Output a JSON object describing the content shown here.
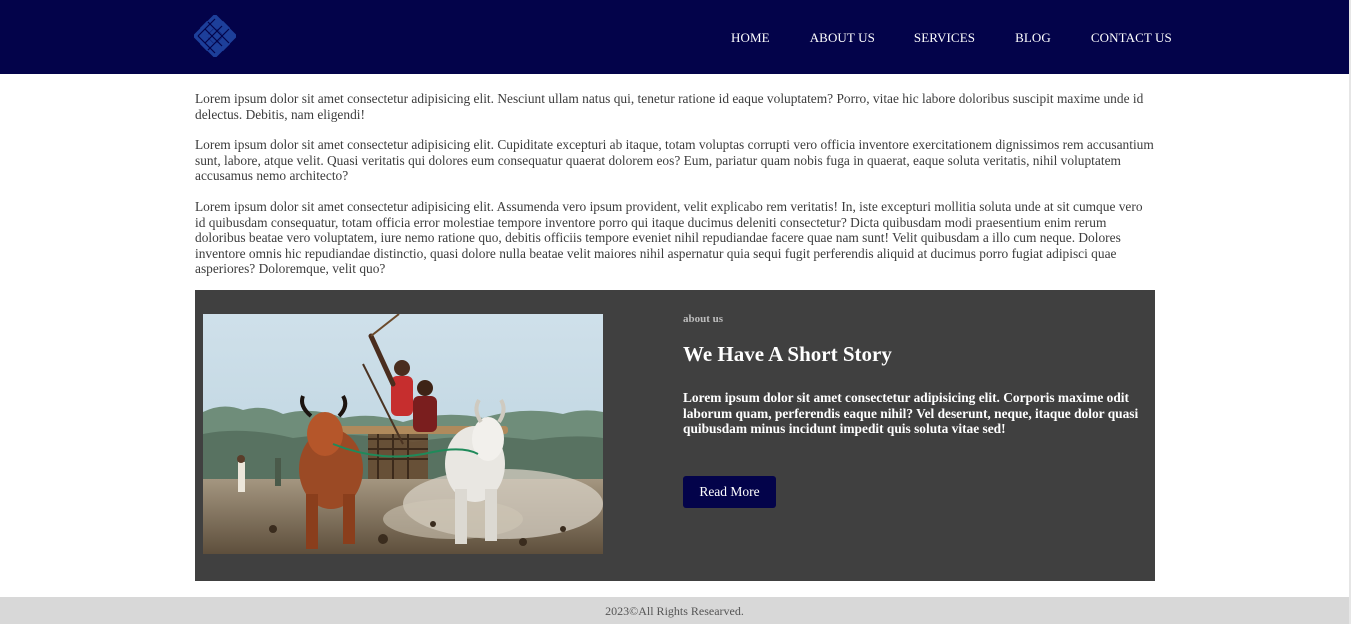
{
  "header": {
    "logo_icon": "diamond-knot-logo-icon",
    "nav": [
      {
        "label": "HOME"
      },
      {
        "label": "ABOUT US"
      },
      {
        "label": "SERVICES"
      },
      {
        "label": "BLOG"
      },
      {
        "label": "CONTACT US"
      }
    ]
  },
  "intro": {
    "paragraphs": [
      "Lorem ipsum dolor sit amet consectetur adipisicing elit. Nesciunt ullam natus qui, tenetur ratione id eaque voluptatem? Porro, vitae hic labore doloribus suscipit maxime unde id delectus. Debitis, nam eligendi!",
      "Lorem ipsum dolor sit amet consectetur adipisicing elit. Cupiditate excepturi ab itaque, totam voluptas corrupti vero officia inventore exercitationem dignissimos rem accusantium sunt, labore, atque velit. Quasi veritatis qui dolores eum consequatur quaerat dolorem eos? Eum, pariatur quam nobis fuga in quaerat, eaque soluta veritatis, nihil voluptatem accusamus nemo architecto?",
      "Lorem ipsum dolor sit amet consectetur adipisicing elit. Assumenda vero ipsum provident, velit explicabo rem veritatis! In, iste excepturi mollitia soluta unde at sit cumque vero id quibusdam consequatur, totam officia error molestiae tempore inventore porro qui itaque ducimus deleniti consectetur? Dicta quibusdam modi praesentium enim rerum doloribus beatae vero voluptatem, iure nemo ratione quo, debitis officiis tempore eveniet nihil repudiandae facere quae nam sunt! Velit quibusdam a illo cum neque. Dolores inventore omnis hic repudiandae distinctio, quasi dolore nulla beatae velit maiores nihil aspernatur quia sequi fugit perferendis aliquid at ducimus porro fugiat adipisci quae asperiores? Doloremque, velit quo?"
    ]
  },
  "about": {
    "image_icon": "bull-race-photo",
    "kicker": "about us",
    "title": "We Have A Short Story",
    "text": "Lorem ipsum dolor sit amet consectetur adipisicing elit. Corporis maxime odit laborum quam, perferendis eaque nihil? Vel deserunt, neque, itaque dolor quasi quibusdam minus incidunt impedit quis soluta vitae sed!",
    "button_label": "Read More"
  },
  "footer": {
    "copyright": "2023©All Rights Researved."
  },
  "colors": {
    "header_bg": "#03034a",
    "about_bg": "#404040",
    "footer_bg": "#d8d8d8",
    "button_bg": "#03034a",
    "logo_blue": "#1d3f9a"
  }
}
